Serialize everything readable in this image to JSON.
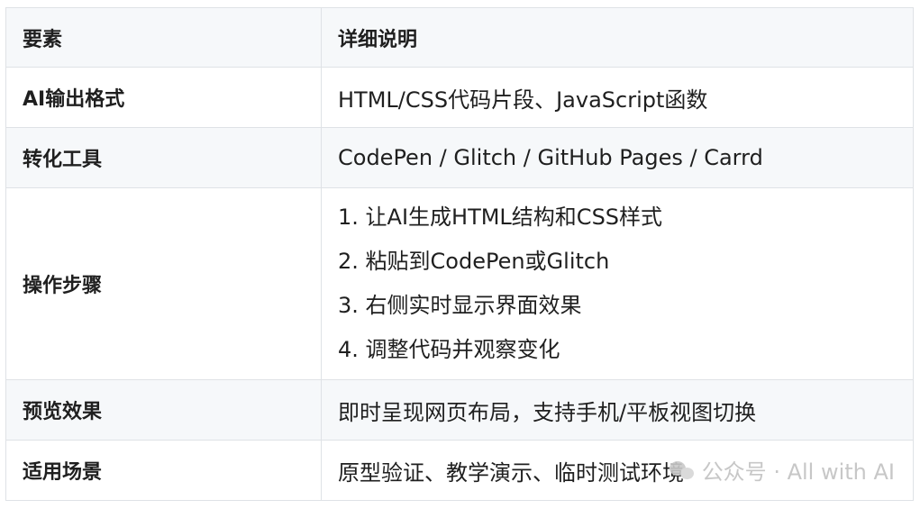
{
  "table": {
    "headers": [
      "要素",
      "详细说明"
    ],
    "rows": [
      {
        "key": "AI输出格式",
        "value": "HTML/CSS代码片段、JavaScript函数"
      },
      {
        "key": "转化工具",
        "value": "CodePen / Glitch / GitHub Pages / Carrd"
      },
      {
        "key": "操作步骤",
        "steps": [
          "1. 让AI生成HTML结构和CSS样式",
          "2. 粘贴到CodePen或Glitch",
          "3. 右侧实时显示界面效果",
          "4. 调整代码并观察变化"
        ]
      },
      {
        "key": "预览效果",
        "value": "即时呈现网页布局，支持手机/平板视图切换"
      },
      {
        "key": "适用场景",
        "value": "原型验证、教学演示、临时测试环境"
      }
    ]
  },
  "watermark": {
    "icon": "wechat-official-account-icon",
    "text": "公众号 · All with AI"
  }
}
